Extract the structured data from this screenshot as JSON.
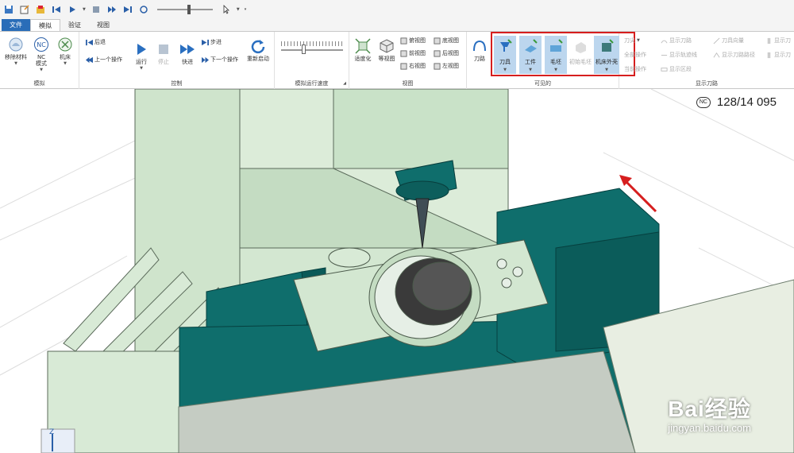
{
  "qat": {
    "icons": [
      "save-icon",
      "export-icon",
      "open-icon",
      "skip-back-icon",
      "play-icon",
      "stop-icon",
      "skip-forward-icon",
      "refresh-icon",
      "pointer-icon"
    ]
  },
  "tabs": [
    {
      "label": "文件"
    },
    {
      "label": "模拟"
    },
    {
      "label": "验证"
    },
    {
      "label": "视图"
    }
  ],
  "ribbon": {
    "sim_group": {
      "label": "模拟",
      "remove_material": "移除材料",
      "nc_mode": "NC\n模式",
      "machine": "机床"
    },
    "control": {
      "label": "控制",
      "back": "后退",
      "prev_op": "上一个操作",
      "run": "运行",
      "stop": "停止",
      "fast": "快进",
      "step": "步进",
      "next_op": "下一个操作",
      "restart": "重新启动"
    },
    "speed": {
      "label": "模拟运行速度"
    },
    "view": {
      "label": "视图",
      "fit": "适度化",
      "iso": "等视图",
      "back_view": "俯视图",
      "bottom_view": "底视图",
      "front_view": "前视图",
      "rear_view": "后视图",
      "right_view": "右视图",
      "left_view": "左视图"
    },
    "visible": {
      "label": "可见的",
      "toolpath": "刀路",
      "tool": "刀具",
      "workpiece": "工件",
      "stock": "毛坯",
      "initial_stock": "初始毛坯",
      "machine_housing": "机床外壳"
    },
    "show_toolpath": {
      "label": "显示刀路",
      "items": [
        "刀尖",
        "显示刀路",
        "刀具向量",
        "显示刀",
        "全部操作",
        "显示轨迹线",
        "显示刀路路径",
        "显示刀",
        "当前操作",
        "显示区段"
      ]
    }
  },
  "viewport": {
    "nc_badge": "NC",
    "counter": "128/14 095",
    "watermark_main": "Bai经验",
    "watermark_sub": "jingyan.baidu.com",
    "colors": {
      "machine_green": "#c9e2c8",
      "fixture_teal": "#0f6e6c",
      "highlight_red": "#d61e1e"
    }
  }
}
